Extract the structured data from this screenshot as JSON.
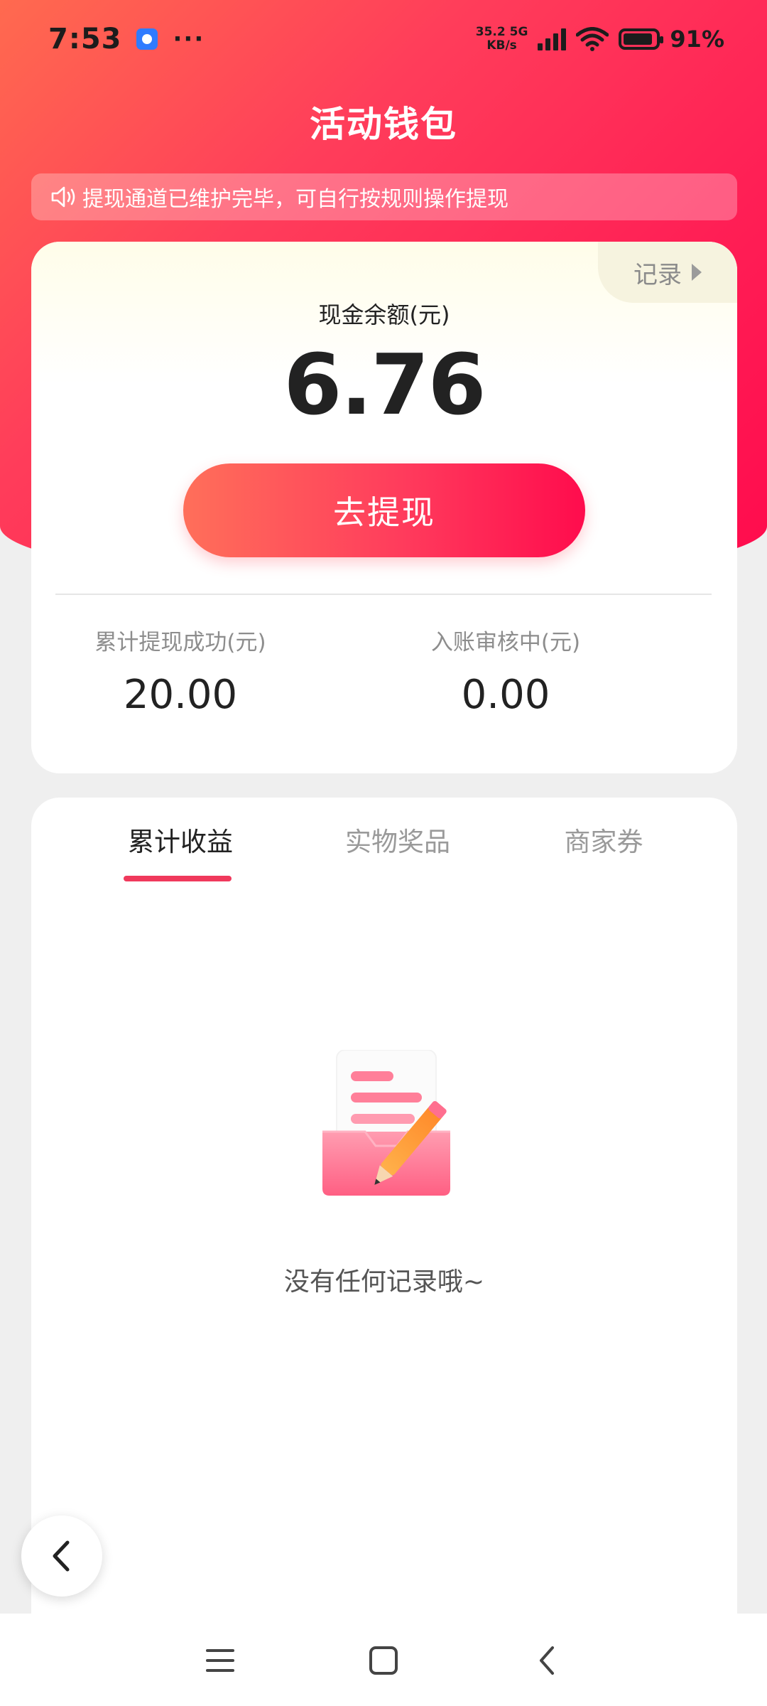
{
  "status_bar": {
    "time": "7:53",
    "more": "···",
    "net_speed_value": "35.2",
    "net_speed_unit": "KB/s",
    "network_type": "5G",
    "battery_percent": "91%",
    "battery_level": 0.91
  },
  "header": {
    "title": "活动钱包"
  },
  "notice": {
    "text": "提现通道已维护完毕，可自行按规则操作提现"
  },
  "balance": {
    "record_label": "记录",
    "label": "现金余额(元)",
    "value": "6.76",
    "withdraw_button": "去提现",
    "stats": [
      {
        "label": "累计提现成功(元)",
        "value": "20.00"
      },
      {
        "label": "入账审核中(元)",
        "value": "0.00"
      }
    ]
  },
  "tabs": {
    "items": [
      {
        "label": "累计收益",
        "active": true
      },
      {
        "label": "实物奖品",
        "active": false
      },
      {
        "label": "商家券",
        "active": false
      }
    ]
  },
  "empty_state": {
    "text": "没有任何记录哦~"
  },
  "colors": {
    "brand_red": "#ff1f55",
    "accent_pink": "#f0395c",
    "page_bg": "#efefef"
  },
  "icons": {
    "notice": "speaker-icon",
    "record": "triangle-right-icon",
    "empty": "document-pencil-icon",
    "float_back": "chevron-left-icon",
    "nav_menu": "menu-icon",
    "nav_home": "home-square-icon",
    "nav_back": "back-icon"
  }
}
